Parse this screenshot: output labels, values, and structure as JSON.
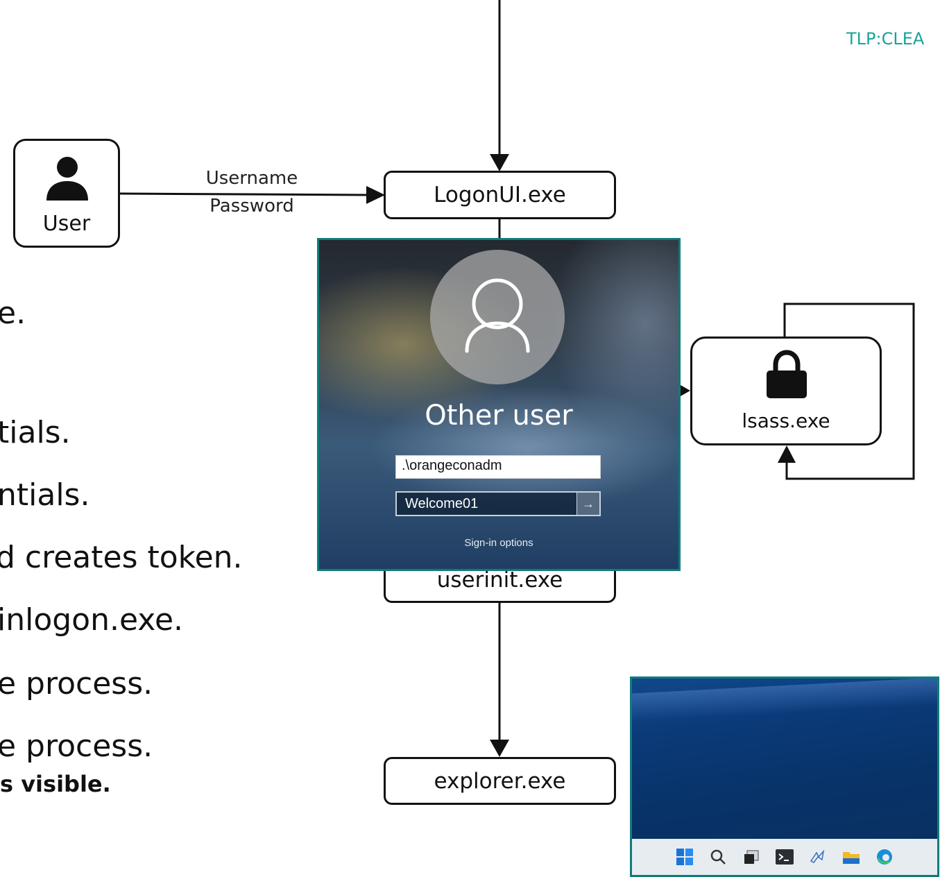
{
  "classification": "TLP:CLEA",
  "nodes": {
    "user": "User",
    "logonui": "LogonUI.exe",
    "lsass": "lsass.exe",
    "userinit": "userinit.exe",
    "explorer": "explorer.exe"
  },
  "edge_labels": {
    "credentials": [
      "Username",
      "Password"
    ]
  },
  "left_text": [
    "e.",
    "tials.",
    "ntials.",
    "d creates token.",
    "inlogon.exe.",
    "e process.",
    "e process."
  ],
  "left_bold": "s visible.",
  "logon_screen": {
    "title": "Other user",
    "username_value": ".\\orangeconadm",
    "password_value": "Welcome01",
    "submit_icon": "arrow-right-icon",
    "sign_in_options": "Sign-in options"
  },
  "taskbar_icons": [
    "start-icon",
    "search-icon",
    "task-view-icon",
    "terminal-icon",
    "app-icon",
    "file-explorer-icon",
    "edge-icon"
  ],
  "colors": {
    "accent": "#19a39a",
    "screenshot_border": "#0f7c7c"
  }
}
